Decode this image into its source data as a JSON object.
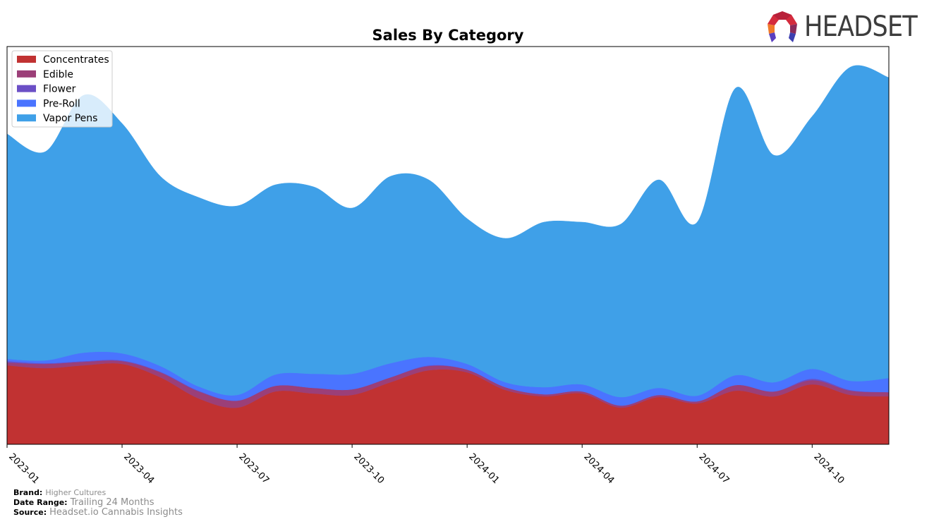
{
  "header": {
    "logo_text": "HEADSET"
  },
  "footer": {
    "brand_label": "Brand:",
    "brand_value": "Higher Cultures",
    "date_range_label": "Date Range:",
    "date_range_value": "Trailing 24 Months",
    "source_label": "Source:",
    "source_value": "Headset.io Cannabis Insights"
  },
  "chart_data": {
    "type": "area",
    "stacked": true,
    "title": "Sales By Category",
    "xlabel": "",
    "ylabel": "",
    "y_axis_visible": false,
    "grid": false,
    "legend_position": "top-left",
    "x": [
      "2023-01",
      "2023-02",
      "2023-03",
      "2023-04",
      "2023-05",
      "2023-06",
      "2023-07",
      "2023-08",
      "2023-09",
      "2023-10",
      "2023-11",
      "2023-12",
      "2024-01",
      "2024-02",
      "2024-03",
      "2024-04",
      "2024-05",
      "2024-06",
      "2024-07",
      "2024-08",
      "2024-09",
      "2024-10",
      "2024-11",
      "2024-12"
    ],
    "x_tick_labels": [
      "2023-01",
      "2023-04",
      "2023-07",
      "2023-10",
      "2024-01",
      "2024-04",
      "2024-07",
      "2024-10"
    ],
    "ylim": [
      0,
      564
    ],
    "series": [
      {
        "name": "Concentrates",
        "color": "#c13232",
        "values": [
          112,
          108,
          112,
          114,
          95,
          65,
          52,
          75,
          72,
          70,
          88,
          105,
          102,
          77,
          68,
          72,
          52,
          67,
          58,
          76,
          68,
          85,
          70,
          68
        ]
      },
      {
        "name": "Edible",
        "color": "#9b3f78",
        "values": [
          4,
          6,
          5,
          4,
          7,
          10,
          10,
          8,
          8,
          8,
          7,
          6,
          4,
          4,
          3,
          3,
          3,
          3,
          3,
          8,
          7,
          6,
          6,
          6
        ]
      },
      {
        "name": "Flower",
        "color": "#6b4fc6",
        "values": [
          2,
          1,
          1,
          1,
          1,
          1,
          0,
          0,
          0,
          0,
          0,
          1,
          0,
          0,
          0,
          0,
          0,
          0,
          0,
          0,
          0,
          2,
          1,
          0
        ]
      },
      {
        "name": "Pre-Roll",
        "color": "#4a74ff",
        "values": [
          3,
          4,
          12,
          10,
          8,
          6,
          8,
          16,
          20,
          22,
          20,
          12,
          8,
          7,
          10,
          10,
          12,
          10,
          8,
          14,
          13,
          14,
          13,
          20
        ]
      },
      {
        "name": "Vapor Pens",
        "color": "#3fa0e8",
        "values": [
          319,
          296,
          365,
          326,
          269,
          268,
          268,
          269,
          265,
          235,
          265,
          251,
          206,
          204,
          234,
          230,
          245,
          295,
          246,
          407,
          322,
          358,
          445,
          426
        ]
      }
    ]
  }
}
